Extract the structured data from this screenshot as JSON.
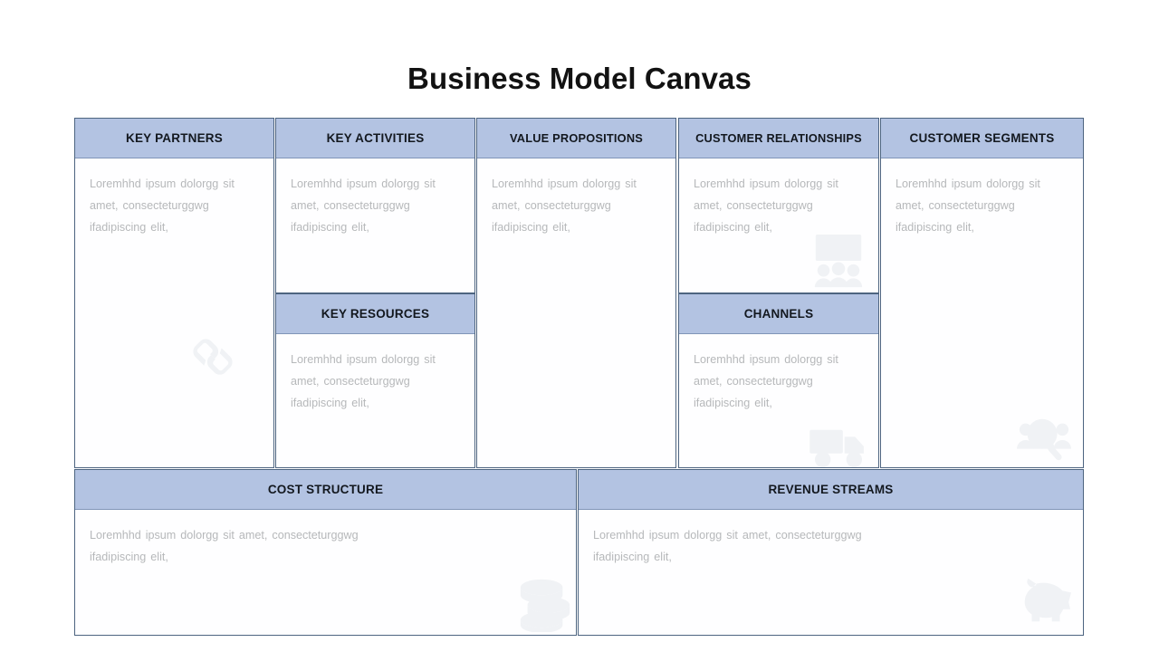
{
  "page": {
    "title": "Business Model Canvas",
    "header_bg": "#b3c3e2",
    "border_color": "#4d6480",
    "body_text_color": "#b6b8ba",
    "watermark_color": "#f0f2f5"
  },
  "body_text": {
    "narrow": "Loremhhd ipsum dolorgg sit amet, consecteturggwg ifadipiscing  elit,",
    "wide": "Loremhhd ipsum dolorgg sit amet, consecteturggwg ifadipiscing  elit,"
  },
  "blocks": [
    {
      "id": "key-partners",
      "title": "KEY PARTNERS",
      "text": "Loremhhd ipsum dolorgg sit amet, consecteturggwg ifadipiscing  elit,",
      "icon": "chain-link-icon"
    },
    {
      "id": "key-activities",
      "title": "KEY ACTIVITIES",
      "text": "Loremhhd ipsum dolorgg sit amet, consecteturggwg ifadipiscing  elit,",
      "icon": "person-icon"
    },
    {
      "id": "key-resources",
      "title": "KEY RESOURCES",
      "text": "Loremhhd ipsum dolorgg sit amet, consecteturggwg ifadipiscing  elit,",
      "icon": "gear-icon"
    },
    {
      "id": "value-propositions",
      "title": "VALUE PROPOSITIONS",
      "text": "Loremhhd ipsum dolorgg sit amet, consecteturggwg ifadipiscing  elit,",
      "icon": "open-box-icon"
    },
    {
      "id": "customer-relationships",
      "title": "CUSTOMER RELATIONSHIPS",
      "text": "Loremhhd ipsum dolorgg sit amet, consecteturggwg ifadipiscing  elit,",
      "icon": "presentation-audience-icon"
    },
    {
      "id": "channels",
      "title": "CHANNELS",
      "text": "Loremhhd ipsum dolorgg sit amet, consecteturggwg ifadipiscing  elit,",
      "icon": "delivery-truck-icon"
    },
    {
      "id": "customer-segments",
      "title": "CUSTOMER SEGMENTS",
      "text": "Loremhhd ipsum dolorgg sit amet, consecteturggwg ifadipiscing  elit,",
      "icon": "magnifier-people-icon"
    },
    {
      "id": "cost-structure",
      "title": "COST STRUCTURE",
      "text": "Loremhhd ipsum dolorgg sit amet, consecteturggwg ifadipiscing  elit,",
      "icon": "stacked-coins-icon"
    },
    {
      "id": "revenue-streams",
      "title": "REVENUE STREAMS",
      "text": "Loremhhd ipsum dolorgg sit amet, consecteturggwg ifadipiscing  elit,",
      "icon": "piggy-bank-icon"
    }
  ]
}
